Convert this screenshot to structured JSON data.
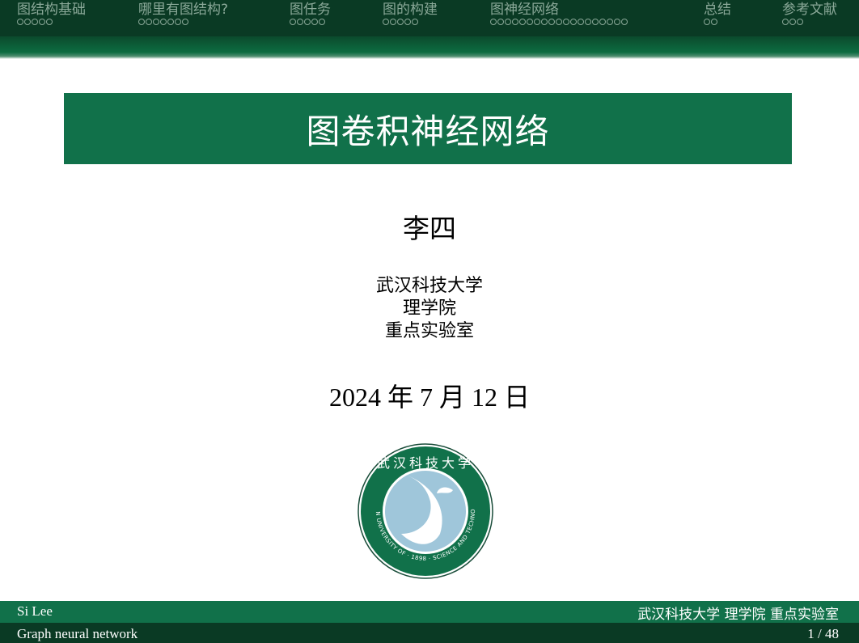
{
  "nav": {
    "sections": [
      {
        "label": "图结构基础",
        "dots": 5
      },
      {
        "label": "哪里有图结构?",
        "dots": 7
      },
      {
        "label": "图任务",
        "dots": 5
      },
      {
        "label": "图的构建",
        "dots": 5
      },
      {
        "label": "图神经网络",
        "dots": 19
      },
      {
        "label": "总结",
        "dots": 2
      },
      {
        "label": "参考文献",
        "dots": 3
      }
    ]
  },
  "title_slide": {
    "title": "图卷积神经网络",
    "author": "李四",
    "institution": [
      "武汉科技大学",
      "理学院",
      "重点实验室"
    ],
    "date": "2024 年 7 月 12 日"
  },
  "logo": {
    "seal_text": "武汉科技大学",
    "english_text": "WUHAN UNIVERSITY OF · 1898 · SCIENCE AND TECHNOLOGY"
  },
  "footer": {
    "author_short": "Si Lee",
    "institute_short": "武汉科技大学 理学院 重点实验室",
    "title_short": "Graph neural network",
    "page": "1 / 48"
  },
  "colors": {
    "dark_green": "#0a3a24",
    "accent_green": "#11714a",
    "nav_text": "#8aa898"
  }
}
